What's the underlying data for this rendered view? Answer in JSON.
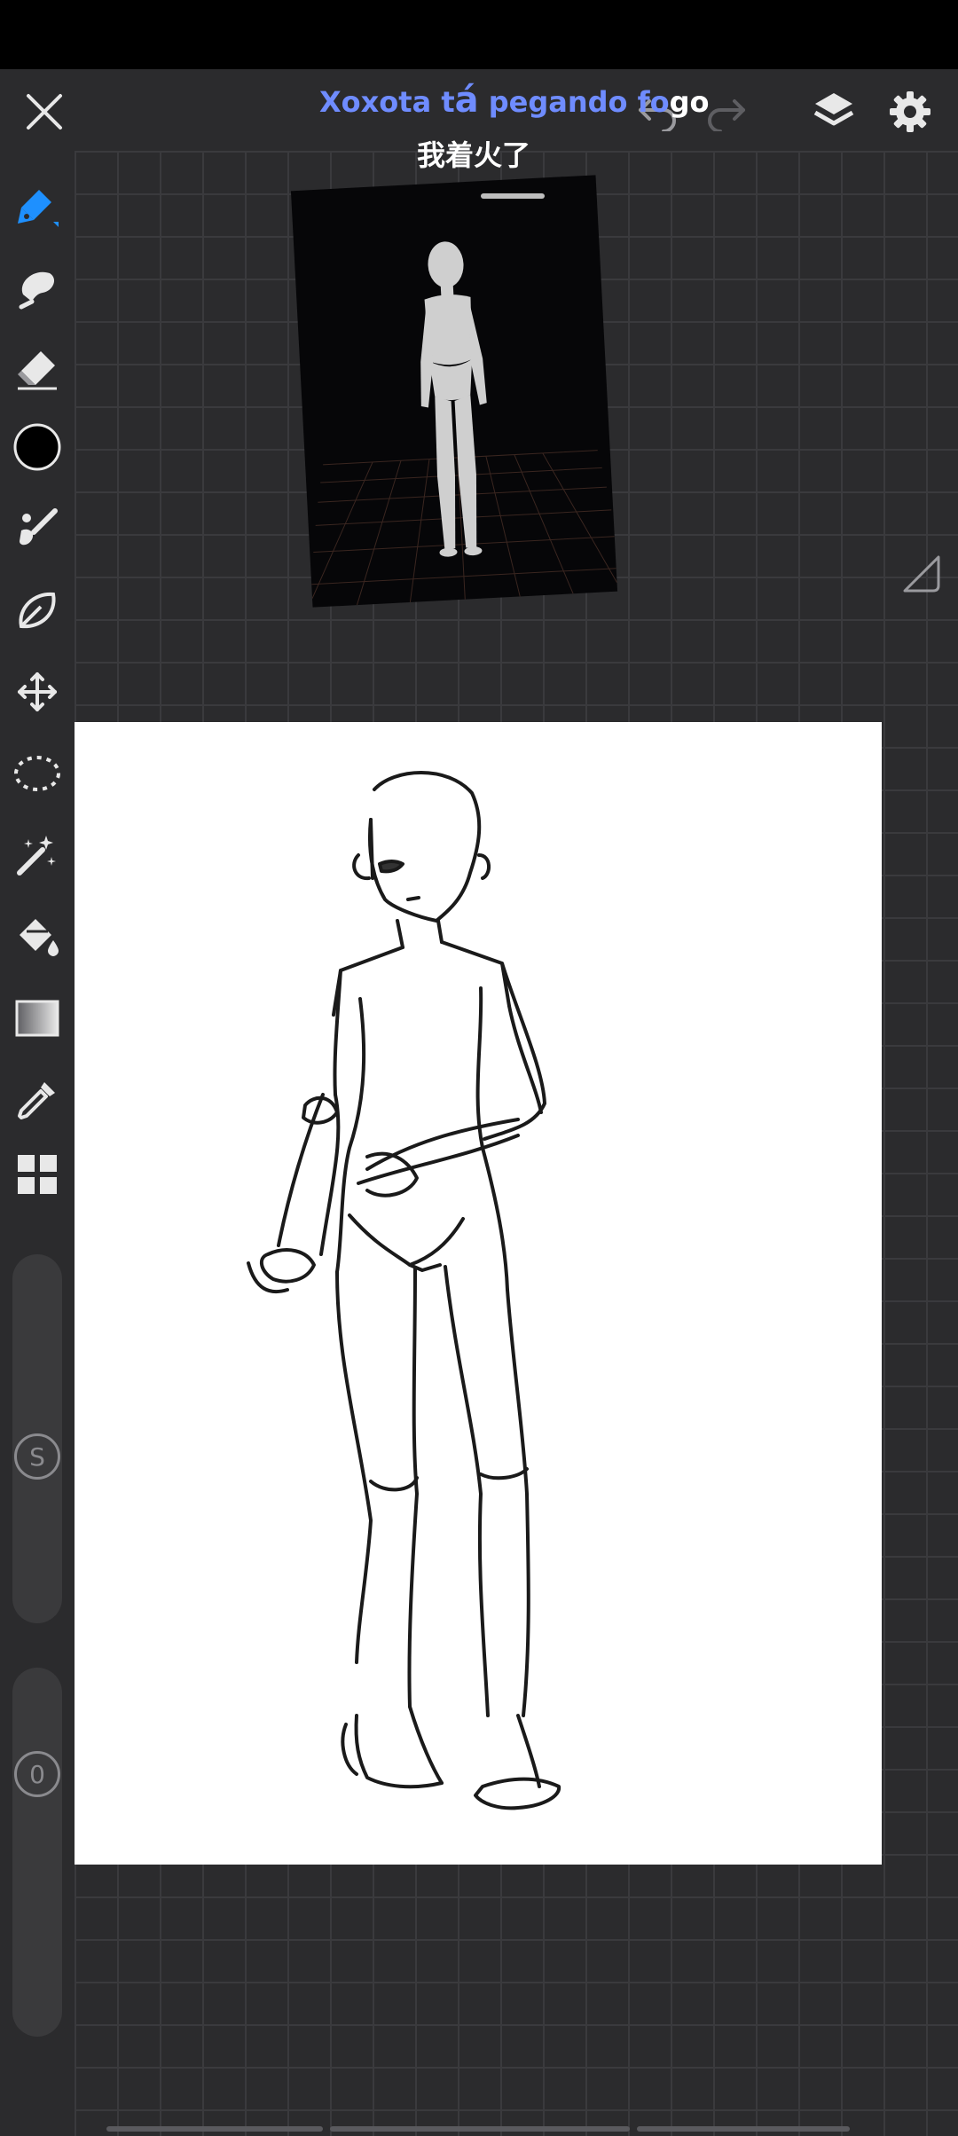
{
  "subtitle": {
    "line1_part1": "Xoxota t",
    "line1_part2": "á",
    "line1_part3": " pegando fo",
    "line1_part4": "go",
    "line2": "我着火了"
  },
  "colors": {
    "accent_blue": "#1e90ff",
    "subtitle_blue": "#6f8cff",
    "background": "#2b2b2d",
    "icon_light": "#e8e8e8"
  },
  "toolbar": {
    "top": [
      "close-icon",
      "undo-icon",
      "redo-icon",
      "layers-icon",
      "settings-icon"
    ],
    "left_tools": [
      "brush-tool-icon",
      "smudge-tool-icon",
      "eraser-tool-icon",
      "color-swatch",
      "paint-blend-icon",
      "lasso-shape-icon",
      "transform-move-icon",
      "selection-icon",
      "magic-wand-icon",
      "fill-bucket-icon",
      "gradient-icon",
      "eyedropper-icon",
      "quick-menu-icon"
    ],
    "active_color": "#000000",
    "size_slider_label": "S",
    "opacity_slider_label": "0"
  }
}
